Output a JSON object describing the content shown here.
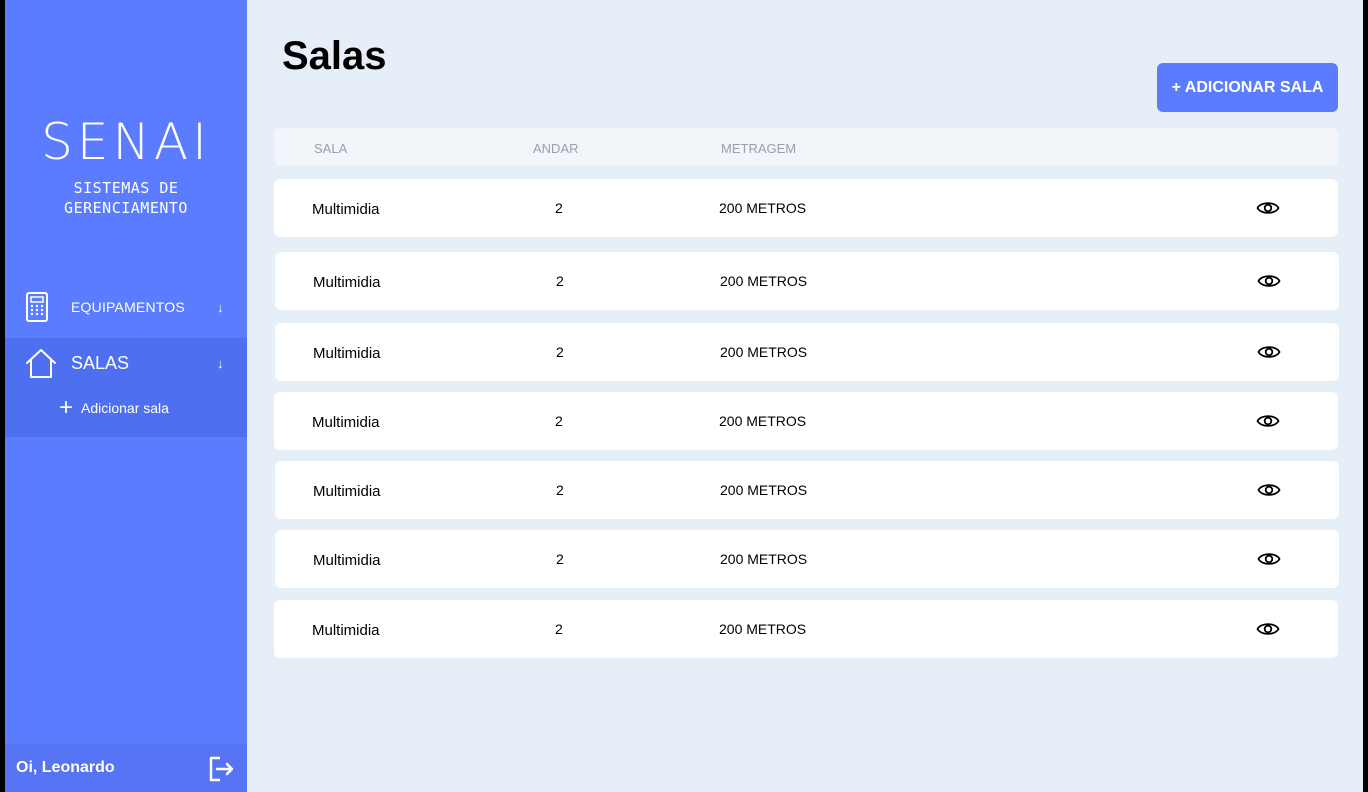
{
  "sidebar": {
    "logo_title": "SENAI",
    "logo_subtitle_line1": "SISTEMAS DE",
    "logo_subtitle_line2": "GERENCIAMENTO",
    "items": [
      {
        "label": "EQUIPAMENTOS",
        "icon": "calculator-icon",
        "arrow": "↓"
      },
      {
        "label": "SALAS",
        "icon": "house-icon",
        "arrow": "↓"
      }
    ],
    "sub_item": {
      "plus": "+",
      "label": "Adicionar sala"
    },
    "user_greeting": "Oi, Leonardo",
    "logout_icon": "logout-icon"
  },
  "main": {
    "title": "Salas",
    "add_button_label": "+ ADICIONAR SALA",
    "columns": [
      "SALA",
      "ANDAR",
      "METRAGEM"
    ],
    "rows": [
      {
        "sala": "Multimidia",
        "andar": "2",
        "metragem": "200 METROS"
      },
      {
        "sala": "Multimidia",
        "andar": "2",
        "metragem": "200 METROS"
      },
      {
        "sala": "Multimidia",
        "andar": "2",
        "metragem": "200 METROS"
      },
      {
        "sala": "Multimidia",
        "andar": "2",
        "metragem": "200 METROS"
      },
      {
        "sala": "Multimidia",
        "andar": "2",
        "metragem": "200 METROS"
      },
      {
        "sala": "Multimidia",
        "andar": "2",
        "metragem": "200 METROS"
      },
      {
        "sala": "Multimidia",
        "andar": "2",
        "metragem": "200 METROS"
      }
    ]
  },
  "colors": {
    "sidebar": "#5B7CFF",
    "accent": "#5B7CFF",
    "background": "#E6EEF8"
  }
}
